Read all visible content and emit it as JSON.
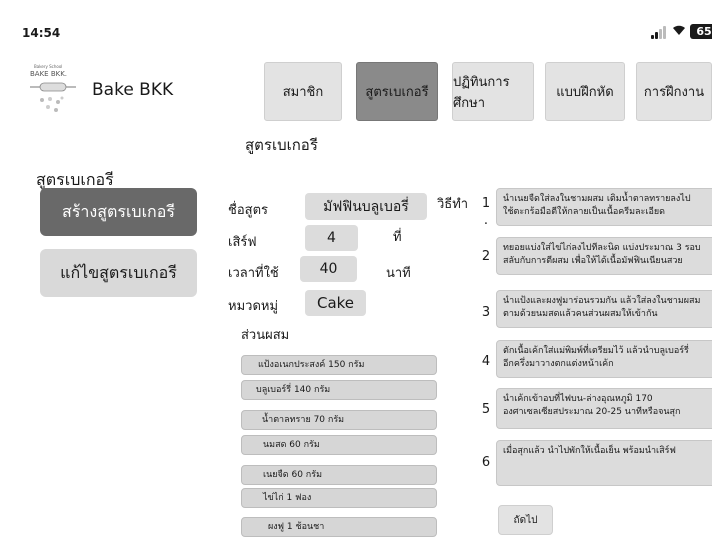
{
  "status": {
    "time": "14:54",
    "battery": "65"
  },
  "brand": {
    "name": "Bake BKK",
    "logo_text": "Bakery School BAKE BKK."
  },
  "nav": {
    "tabs": [
      {
        "label": "สมาชิก"
      },
      {
        "label": "สูตรเบเกอรี"
      },
      {
        "label": "ปฏิทินการศึกษา"
      },
      {
        "label": "แบบฝึกหัด"
      },
      {
        "label": "การฝึกงาน"
      }
    ]
  },
  "page": {
    "section_title": "สูตรเบเกอรี",
    "sidebar_title": "สูตรเบเกอรี"
  },
  "sidebar": {
    "create_label": "สร้างสูตรเบเกอรี",
    "edit_label": "แก้ไขสูตรเบเกอรี"
  },
  "form": {
    "name_label": "ชื่อสูตร",
    "name_value": "มัฟฟินบลูเบอรี่",
    "serve_label": "เสิร์ฟ",
    "serve_value": "4",
    "serve_unit": "ที่",
    "time_label": "เวลาที่ใช้",
    "time_value": "40",
    "time_unit": "นาที",
    "category_label": "หมวดหมู่",
    "category_value": "Cake",
    "ingredients_label": "ส่วนผสม",
    "method_label": "วิธีทำ"
  },
  "ingredients": [
    "แป้งอเนกประสงค์ 150 กรัม",
    "บลูเบอร์รี่ 140 กรัม",
    "น้ำตาลทราย 70 กรัม",
    "นมสด 60 กรัม",
    "เนยจืด 60 กรัม",
    "ไข่ไก่ 1 ฟอง",
    "ผงฟู 1 ช้อนชา"
  ],
  "steps": [
    {
      "num": "1",
      "line1": "นำเนยจืดใส่ลงในชามผสม เติมน้ำตาลทรายลงไป",
      "line2": "ใช้ตะกร้อมือตีให้กลายเป็นเนื้อครีมละเอียด"
    },
    {
      "num": "2",
      "line1": "ทยอยแบ่งใส่ไข่ไก่ลงไปทีละนิด แบ่งประมาณ 3 รอบ",
      "line2": "สลับกับการตีผสม เพื่อให้ได้เนื้อมัฟฟินเนียนสวย"
    },
    {
      "num": "3",
      "line1": "นำแป้งและผงฟูมาร่อนรวมกัน แล้วใส่ลงในชามผสม",
      "line2": "ตามด้วยนมสดแล้วคนส่วนผสมให้เข้ากัน"
    },
    {
      "num": "4",
      "line1": "ตักเนื้อเค้กใส่แม่พิมพ์ที่เตรียมไว้ แล้วนำบลูเบอร์รี่",
      "line2": "อีกครึ่งมาวางตกแต่งหน้าเค้ก"
    },
    {
      "num": "5",
      "line1": "นำเค้กเข้าอบที่ไฟบน-ล่างอุณหภูมิ 170",
      "line2": "องศาเซลเซียสประมาณ 20-25 นาทีหรือจนสุก"
    },
    {
      "num": "6",
      "line1": "เมื่อสุกแล้ว นำไปพักให้เนื้อเย็น พร้อมนำเสิร์ฟ",
      "line2": ""
    }
  ],
  "next_label": "ถัดไป"
}
